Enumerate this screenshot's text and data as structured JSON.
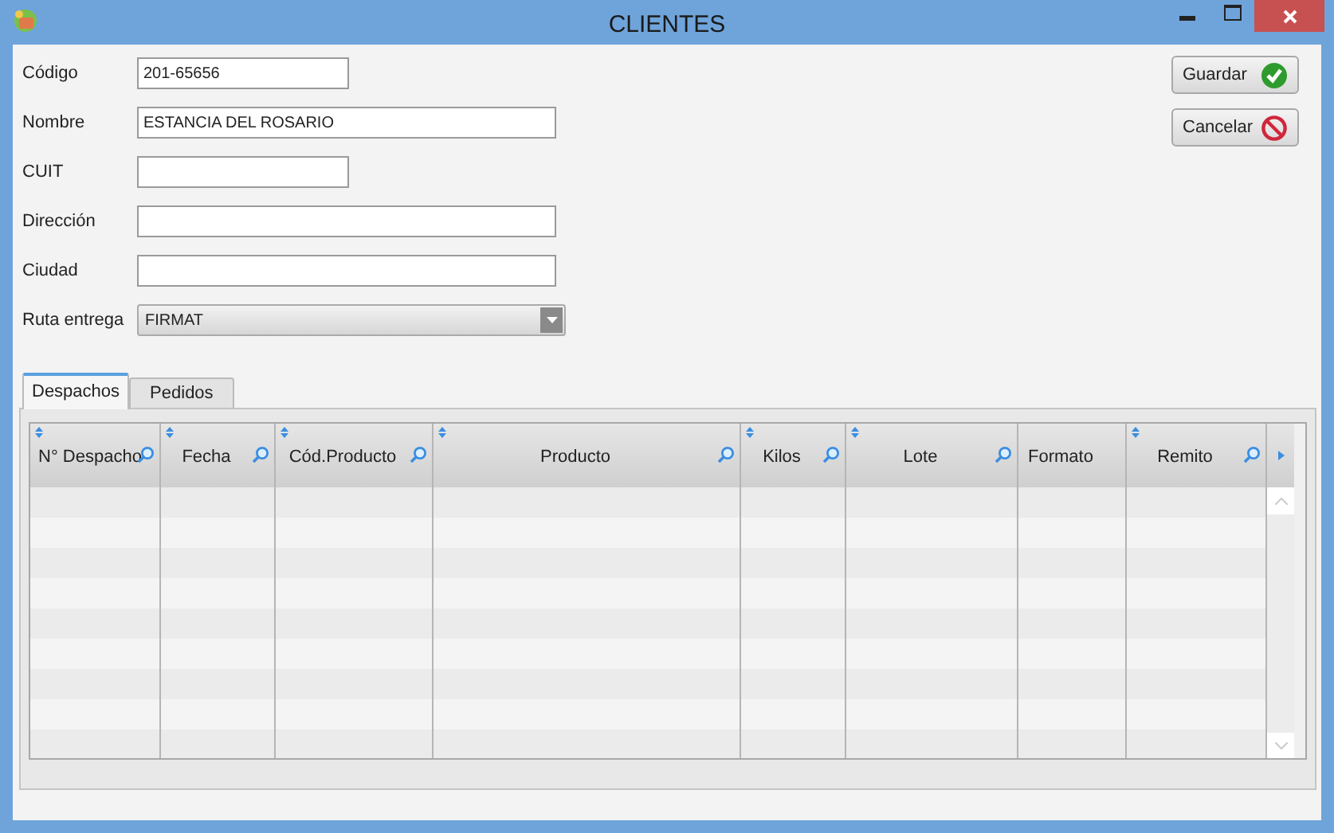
{
  "window": {
    "title": "CLIENTES"
  },
  "fields": [
    {
      "label": "Código",
      "value": "201-65656",
      "kind": "short"
    },
    {
      "label": "Nombre",
      "value": "ESTANCIA DEL ROSARIO",
      "kind": "long"
    },
    {
      "label": "CUIT",
      "kind": "short"
    },
    {
      "label": "Dirección",
      "kind": "long"
    },
    {
      "label": "Ciudad",
      "kind": "long"
    },
    {
      "label": "Ruta entrega",
      "value": "FIRMAT",
      "kind": "dropdown"
    }
  ],
  "buttons": [
    {
      "label": "Guardar",
      "kind": "save"
    },
    {
      "label": "Cancelar",
      "kind": "cancel"
    }
  ],
  "tabs": [
    {
      "label": "Despachos",
      "selected": true
    },
    {
      "label": "Pedidos",
      "selected": false
    }
  ],
  "table": {
    "columns": [
      {
        "label": "N° Despacho",
        "sortable": true,
        "filterable": true
      },
      {
        "label": "Fecha",
        "sortable": true,
        "filterable": true
      },
      {
        "label": "Cód.Producto",
        "sortable": true,
        "filterable": true
      },
      {
        "label": "Producto",
        "sortable": true,
        "filterable": true
      },
      {
        "label": "Kilos",
        "sortable": true,
        "filterable": true
      },
      {
        "label": "Lote",
        "sortable": true,
        "filterable": true
      },
      {
        "label": "Formato",
        "sortable": false,
        "filterable": false
      },
      {
        "label": "Remito",
        "sortable": true,
        "filterable": true
      }
    ]
  }
}
